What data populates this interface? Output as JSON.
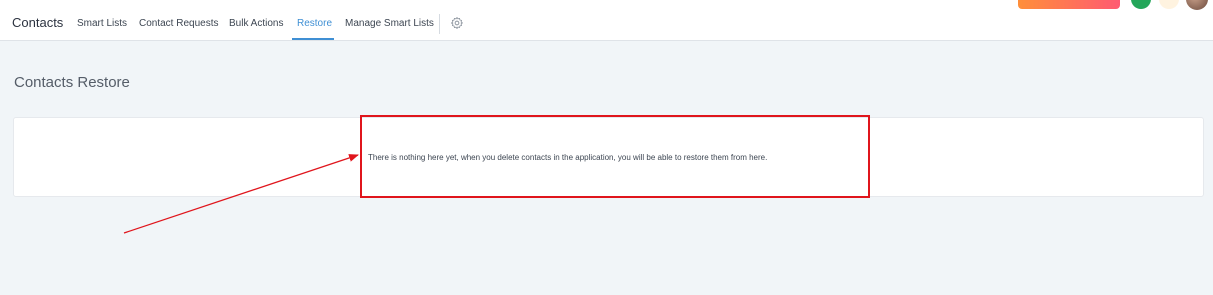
{
  "header": {
    "brand": "Contacts",
    "tabs": [
      {
        "label": "Smart Lists"
      },
      {
        "label": "Contact Requests"
      },
      {
        "label": "Bulk Actions"
      },
      {
        "label": "Restore",
        "active": true
      },
      {
        "label": "Manage Smart Lists"
      }
    ],
    "settings_icon": "gear-icon"
  },
  "page": {
    "title": "Contacts Restore",
    "empty_message": "There is nothing here yet, when you delete contacts in the application, you will be able to restore them from here."
  },
  "annotation": {
    "color": "#e0151c"
  },
  "colors": {
    "accent": "#3f8fd4",
    "background": "#f1f5f8",
    "status_green": "#24a65a"
  }
}
